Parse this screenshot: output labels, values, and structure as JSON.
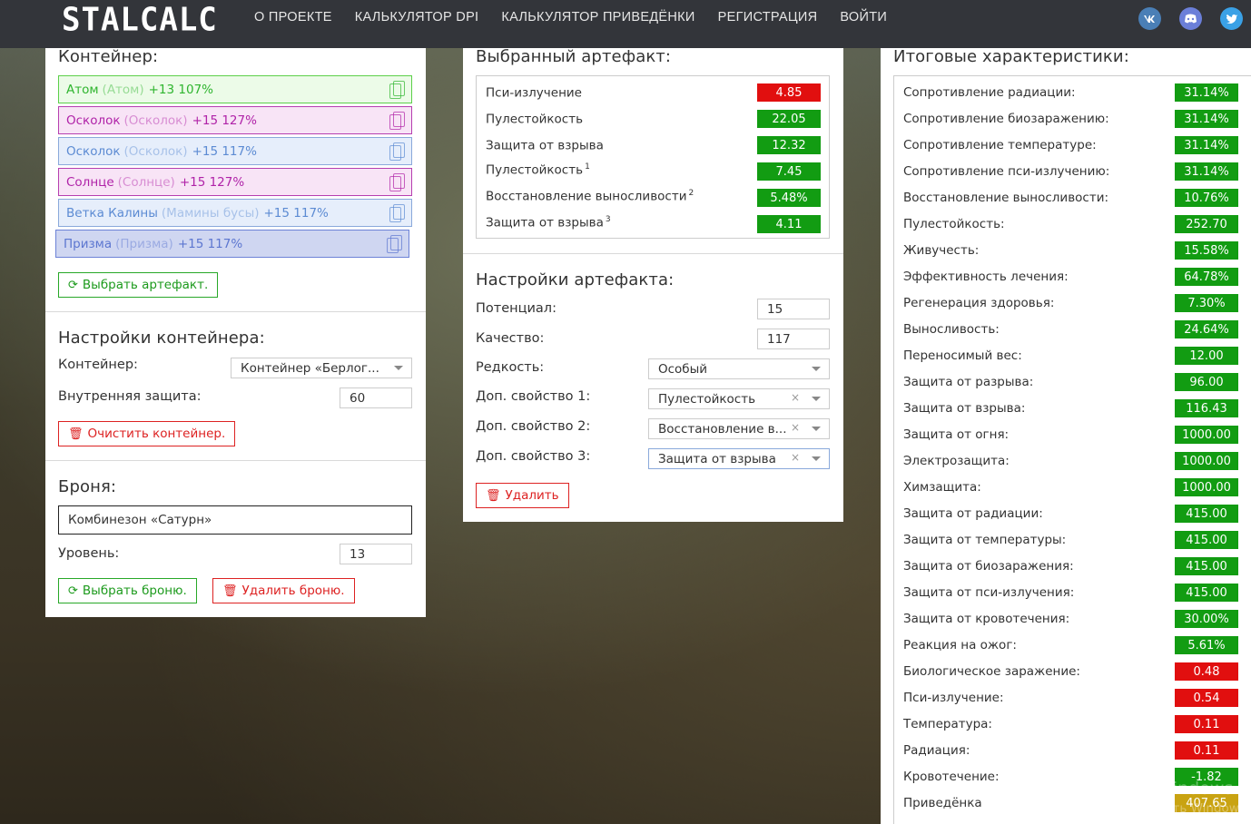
{
  "header": {
    "logo": "STALCALC",
    "nav": [
      "О ПРОЕКТЕ",
      "КАЛЬКУЛЯТОР DPI",
      "КАЛЬКУЛЯТОР ПРИВЕДЁНКИ",
      "РЕГИСТРАЦИЯ",
      "ВОЙТИ"
    ],
    "social": [
      {
        "name": "vk-icon",
        "glyph": "vk"
      },
      {
        "name": "discord-icon",
        "glyph": "ds"
      },
      {
        "name": "twitter-icon",
        "glyph": "tw"
      }
    ]
  },
  "container_panel": {
    "title": "Контейнер:",
    "artifacts": [
      {
        "name": "Атом",
        "alias": "(Атом)",
        "level": "+13 107%",
        "color": "#2fb52f",
        "bg": "#ecfbe8",
        "border": "#5ccf4a"
      },
      {
        "name": "Осколок",
        "alias": "(Осколок)",
        "level": "+15 127%",
        "color": "#b023a8",
        "bg": "#f8e4f6",
        "border": "#b63fb0"
      },
      {
        "name": "Осколок",
        "alias": "(Осколок)",
        "level": "+15 117%",
        "color": "#5c8bd3",
        "bg": "#e6eefb",
        "border": "#8aa9db"
      },
      {
        "name": "Солнце",
        "alias": "(Солнце)",
        "level": "+15 127%",
        "color": "#b023a8",
        "bg": "#f8e4f6",
        "border": "#b63fb0"
      },
      {
        "name": "Ветка Калины",
        "alias": "(Мамины бусы)",
        "level": "+15 117%",
        "color": "#5c8bd3",
        "bg": "#e6eefb",
        "border": "#8aa9db"
      },
      {
        "name": "Призма",
        "alias": "(Призма)",
        "level": "+15 117%",
        "color": "#5c76d0",
        "bg": "#cfd6f1",
        "border": "#6c82d6"
      }
    ],
    "choose_artifact_btn": "Выбрать артефакт.",
    "settings_title": "Настройки контейнера:",
    "container_label": "Контейнер:",
    "container_value": "Контейнер «Берлог...",
    "inner_protection_label": "Внутренняя защита:",
    "inner_protection_value": "60",
    "clear_btn": "Очистить контейнер.",
    "armor_title": "Броня:",
    "armor_value": "Комбинезон «Сатурн»",
    "level_label": "Уровень:",
    "level_value": "13",
    "choose_armor_btn": "Выбрать броню.",
    "delete_armor_btn": "Удалить броню."
  },
  "artifact_panel": {
    "title": "Выбранный артефакт:",
    "stats": [
      {
        "label": "Пси-излучение",
        "sup": "",
        "value": "4.85",
        "kind": "r"
      },
      {
        "label": "Пулестойкость",
        "sup": "",
        "value": "22.05",
        "kind": "g"
      },
      {
        "label": "Защита от взрыва",
        "sup": "",
        "value": "12.32",
        "kind": "g"
      },
      {
        "label": "Пулестойкость",
        "sup": "1",
        "value": "7.45",
        "kind": "g"
      },
      {
        "label": "Восстановление выносливости",
        "sup": "2",
        "value": "5.48%",
        "kind": "g"
      },
      {
        "label": "Защита от взрыва",
        "sup": "3",
        "value": "4.11",
        "kind": "g"
      }
    ],
    "settings_title": "Настройки артефакта:",
    "potential_label": "Потенциал:",
    "potential_value": "15",
    "quality_label": "Качество:",
    "quality_value": "117",
    "rarity_label": "Редкость:",
    "rarity_value": "Особый",
    "prop1_label": "Доп. свойство 1:",
    "prop1_value": "Пулестойкость",
    "prop2_label": "Доп. свойство 2:",
    "prop2_value": "Восстановление в...",
    "prop3_label": "Доп. свойство 3:",
    "prop3_value": "Защита от взрыва",
    "clear_x": "×",
    "delete_btn": "Удалить"
  },
  "totals_panel": {
    "title": "Итоговые характеристики:",
    "stats": [
      {
        "label": "Сопротивление радиации:",
        "value": "31.14%",
        "kind": "g"
      },
      {
        "label": "Сопротивление биозаражению:",
        "value": "31.14%",
        "kind": "g"
      },
      {
        "label": "Сопротивление температуре:",
        "value": "31.14%",
        "kind": "g"
      },
      {
        "label": "Сопротивление пси-излучению:",
        "value": "31.14%",
        "kind": "g"
      },
      {
        "label": "Восстановление выносливости:",
        "value": "10.76%",
        "kind": "g"
      },
      {
        "label": "Пулестойкость:",
        "value": "252.70",
        "kind": "g"
      },
      {
        "label": "Живучесть:",
        "value": "15.58%",
        "kind": "g"
      },
      {
        "label": "Эффективность лечения:",
        "value": "64.78%",
        "kind": "g"
      },
      {
        "label": "Регенерация здоровья:",
        "value": "7.30%",
        "kind": "g"
      },
      {
        "label": "Выносливость:",
        "value": "24.64%",
        "kind": "g"
      },
      {
        "label": "Переносимый вес:",
        "value": "12.00",
        "kind": "g"
      },
      {
        "label": "Защита от разрыва:",
        "value": "96.00",
        "kind": "g"
      },
      {
        "label": "Защита от взрыва:",
        "value": "116.43",
        "kind": "g"
      },
      {
        "label": "Защита от огня:",
        "value": "1000.00",
        "kind": "g"
      },
      {
        "label": "Электрозащита:",
        "value": "1000.00",
        "kind": "g"
      },
      {
        "label": "Химзащита:",
        "value": "1000.00",
        "kind": "g"
      },
      {
        "label": "Защита от радиации:",
        "value": "415.00",
        "kind": "g"
      },
      {
        "label": "Защита от температуры:",
        "value": "415.00",
        "kind": "g"
      },
      {
        "label": "Защита от биозаражения:",
        "value": "415.00",
        "kind": "g"
      },
      {
        "label": "Защита от пси-излучения:",
        "value": "415.00",
        "kind": "g"
      },
      {
        "label": "Защита от кровотечения:",
        "value": "30.00%",
        "kind": "g"
      },
      {
        "label": "Реакция на ожог:",
        "value": "5.61%",
        "kind": "g"
      },
      {
        "label": "Биологическое заражение:",
        "value": "0.48",
        "kind": "r"
      },
      {
        "label": "Пси-излучение:",
        "value": "0.54",
        "kind": "r"
      },
      {
        "label": "Температура:",
        "value": "0.11",
        "kind": "r"
      },
      {
        "label": "Радиация:",
        "value": "0.11",
        "kind": "r"
      },
      {
        "label": "Кровотечение:",
        "value": "-1.82",
        "kind": "g"
      },
      {
        "label": "Приведёнка",
        "value": "407.65",
        "kind": "y"
      }
    ]
  },
  "os_watermark": {
    "line1": "Активация Windows",
    "line2": "Чтобы активировать Windows, п"
  }
}
